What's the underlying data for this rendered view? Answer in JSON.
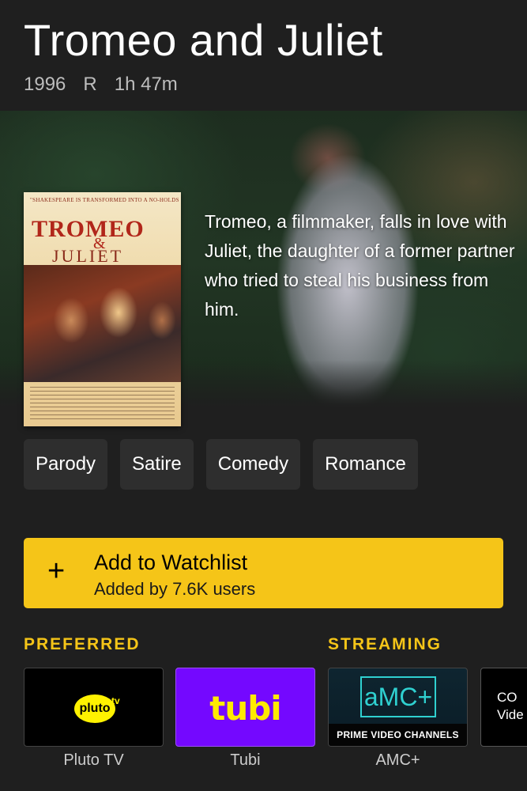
{
  "movie": {
    "title": "Tromeo and Juliet",
    "year": "1996",
    "rating": "R",
    "runtime": "1h 47m",
    "synopsis": "Tromeo, a filmmaker, falls in love with Juliet, the daughter of a former partner who tried to steal his business from him."
  },
  "poster": {
    "tagline": "\"SHAKESPEARE IS TRANSFORMED INTO A NO-HOLDS BARD\"",
    "title_line1": "TROMEO",
    "title_amp": "&",
    "title_line2": "JULIET"
  },
  "genres": [
    "Parody",
    "Satire",
    "Comedy",
    "Romance"
  ],
  "watchlist": {
    "icon": "+",
    "label": "Add to Watchlist",
    "sublabel": "Added by 7.6K users"
  },
  "sections": {
    "preferred": "PREFERRED",
    "streaming": "STREAMING"
  },
  "providers": [
    {
      "name": "Pluto TV",
      "logo_text": "pluto",
      "logo_sup": "tv"
    },
    {
      "name": "Tubi",
      "logo_text": "tubi"
    },
    {
      "name": "AMC+",
      "logo_text": "aMC+",
      "band": "PRIME VIDEO CHANNELS"
    },
    {
      "name": "",
      "logo_text": "CO\nVide"
    }
  ],
  "colors": {
    "background": "#1f1f1f",
    "accent": "#f5c518",
    "chip": "#2e2e2e",
    "tubi": "#7408ff",
    "pluto_yellow": "#fff200",
    "amc_teal": "#2fd0d0"
  }
}
